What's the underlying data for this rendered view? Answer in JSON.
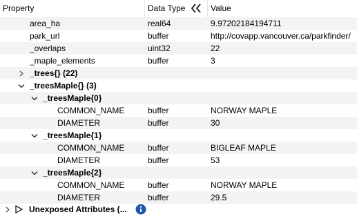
{
  "header": {
    "property": "Property",
    "data_type": "Data Type",
    "value": "Value"
  },
  "rows": [
    {
      "prop": "area_ha",
      "type": "real64",
      "value": "9.97202184194711"
    },
    {
      "prop": "park_url",
      "type": "buffer",
      "value": "http://covapp.vancouver.ca/parkfinder/"
    },
    {
      "prop": "_overlaps",
      "type": "uint32",
      "value": "22"
    },
    {
      "prop": "_maple_elements",
      "type": "buffer",
      "value": "3"
    },
    {
      "prop": "_trees{} (22)"
    },
    {
      "prop": "_treesMaple{} (3)"
    },
    {
      "prop": "_treesMaple{0}"
    },
    {
      "prop": "COMMON_NAME",
      "type": "buffer",
      "value": "NORWAY MAPLE"
    },
    {
      "prop": "DIAMETER",
      "type": "buffer",
      "value": "30"
    },
    {
      "prop": "_treesMaple{1}"
    },
    {
      "prop": "COMMON_NAME",
      "type": "buffer",
      "value": "BIGLEAF MAPLE"
    },
    {
      "prop": "DIAMETER",
      "type": "buffer",
      "value": "53"
    },
    {
      "prop": "_treesMaple{2}"
    },
    {
      "prop": "COMMON_NAME",
      "type": "buffer",
      "value": "NORWAY MAPLE"
    },
    {
      "prop": "DIAMETER",
      "type": "buffer",
      "value": "29.5"
    }
  ],
  "footer": {
    "label": "Unexposed Attributes (..."
  },
  "colors": {
    "info_icon": "#1e58a8",
    "separator": "#e5e5e5",
    "alt_row": "#f3f3f3"
  }
}
